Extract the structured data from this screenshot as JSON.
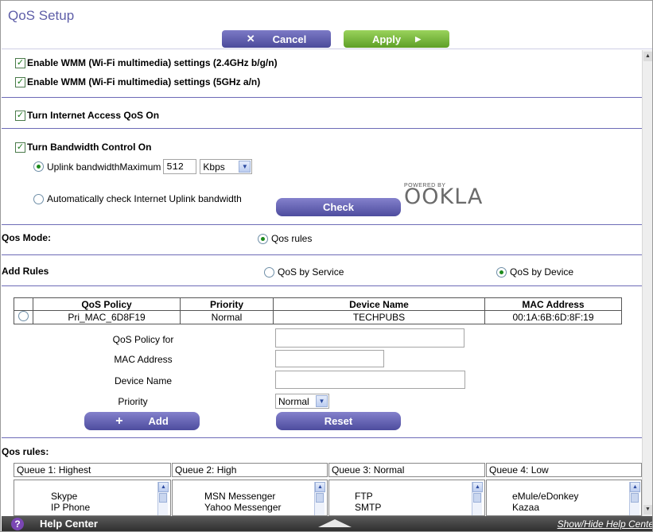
{
  "header": {
    "title": "QoS Setup",
    "cancel_label": "Cancel",
    "apply_label": "Apply"
  },
  "wmm": {
    "opt_24": "Enable WMM (Wi-Fi multimedia) settings (2.4GHz b/g/n)",
    "opt_5": "Enable WMM (Wi-Fi multimedia) settings (5GHz a/n)"
  },
  "internet_qos": "Turn Internet Access QoS On",
  "bandwidth": {
    "title": "Turn Bandwidth Control On",
    "uplink_label": "Uplink bandwidthMaximum",
    "uplink_value": "512",
    "unit": "Kbps",
    "auto_label": "Automatically check Internet Uplink bandwidth",
    "check_label": "Check",
    "powered_by": "POWERED BY",
    "ookla": "OOKLA"
  },
  "qos_mode": {
    "label": "Qos Mode:",
    "option": "Qos rules"
  },
  "add_rules": {
    "label": "Add Rules",
    "by_service": "QoS by Service",
    "by_device": "QoS by Device"
  },
  "table": {
    "headers": [
      "QoS Policy",
      "Priority",
      "Device Name",
      "MAC Address"
    ],
    "rows": [
      {
        "policy": "Pri_MAC_6D8F19",
        "priority": "Normal",
        "device": "TECHPUBS",
        "mac": "00:1A:6B:6D:8F:19"
      }
    ]
  },
  "form": {
    "policy_label": "QoS Policy for",
    "mac_label": "MAC Address",
    "device_label": "Device Name",
    "priority_label": "Priority",
    "priority_value": "Normal",
    "add_label": "Add",
    "reset_label": "Reset"
  },
  "queues": {
    "label": "Qos rules:",
    "items": [
      {
        "title": "Queue 1: Highest",
        "entries": [
          "Skype",
          "IP Phone"
        ]
      },
      {
        "title": "Queue 2: High",
        "entries": [
          "MSN Messenger",
          "Yahoo Messenger"
        ]
      },
      {
        "title": "Queue 3: Normal",
        "entries": [
          "FTP",
          "SMTP"
        ]
      },
      {
        "title": "Queue 4: Low",
        "entries": [
          "eMule/eDonkey",
          "Kazaa"
        ]
      }
    ]
  },
  "footer": {
    "help": "Help Center",
    "link": "Show/Hide Help Center"
  }
}
